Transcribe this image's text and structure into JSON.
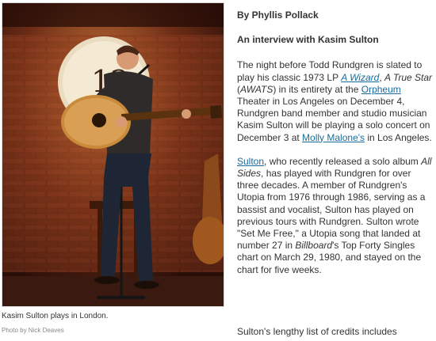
{
  "photo": {
    "alt": "Kasim Sulton playing guitar on stage",
    "caption": "Kasim Sulton plays in London.",
    "credit": "Photo by Nick Deaves"
  },
  "article": {
    "byline": "By Phyllis Pollack",
    "subhead": "An interview with Kasim Sulton",
    "p1": {
      "t1": "The night before Todd Rundgren is slated to play his classic 1973 LP ",
      "link_wizard": "A Wizard",
      "t2": ", ",
      "italic_true_star": "A True Star",
      "t3": " (",
      "italic_awats": "AWATS",
      "t4": ") in its entirety at the ",
      "link_orpheum": "Orpheum",
      "t5": " Theater in Los Angeles on December 4, Rundgren band member and studio musician Kasim Sulton will be playing a solo concert on December 3 at ",
      "link_molly": "Molly Malone's",
      "t6": " in Los Angeles."
    },
    "p2": {
      "link_sulton": "Sulton",
      "t1": ", who recently released a solo album ",
      "italic_album": "All Sides",
      "t2": ", has played with Rundgren for over three decades. A member of Rundgren's Utopia from 1976 through 1986, serving as a bassist and vocalist, Sulton has played on previous tours with Rundgren. Sulton wrote \"Set Me Free,\" a Utopia song that landed at number 27 in ",
      "italic_billboard": "Billboard",
      "t3": "'s Top Forty Singles chart on March 29, 1980, and stayed on the chart for five weeks."
    },
    "p3_partial": "Sulton's lengthy list of credits includes",
    "link_color": "#1a6b9c"
  }
}
